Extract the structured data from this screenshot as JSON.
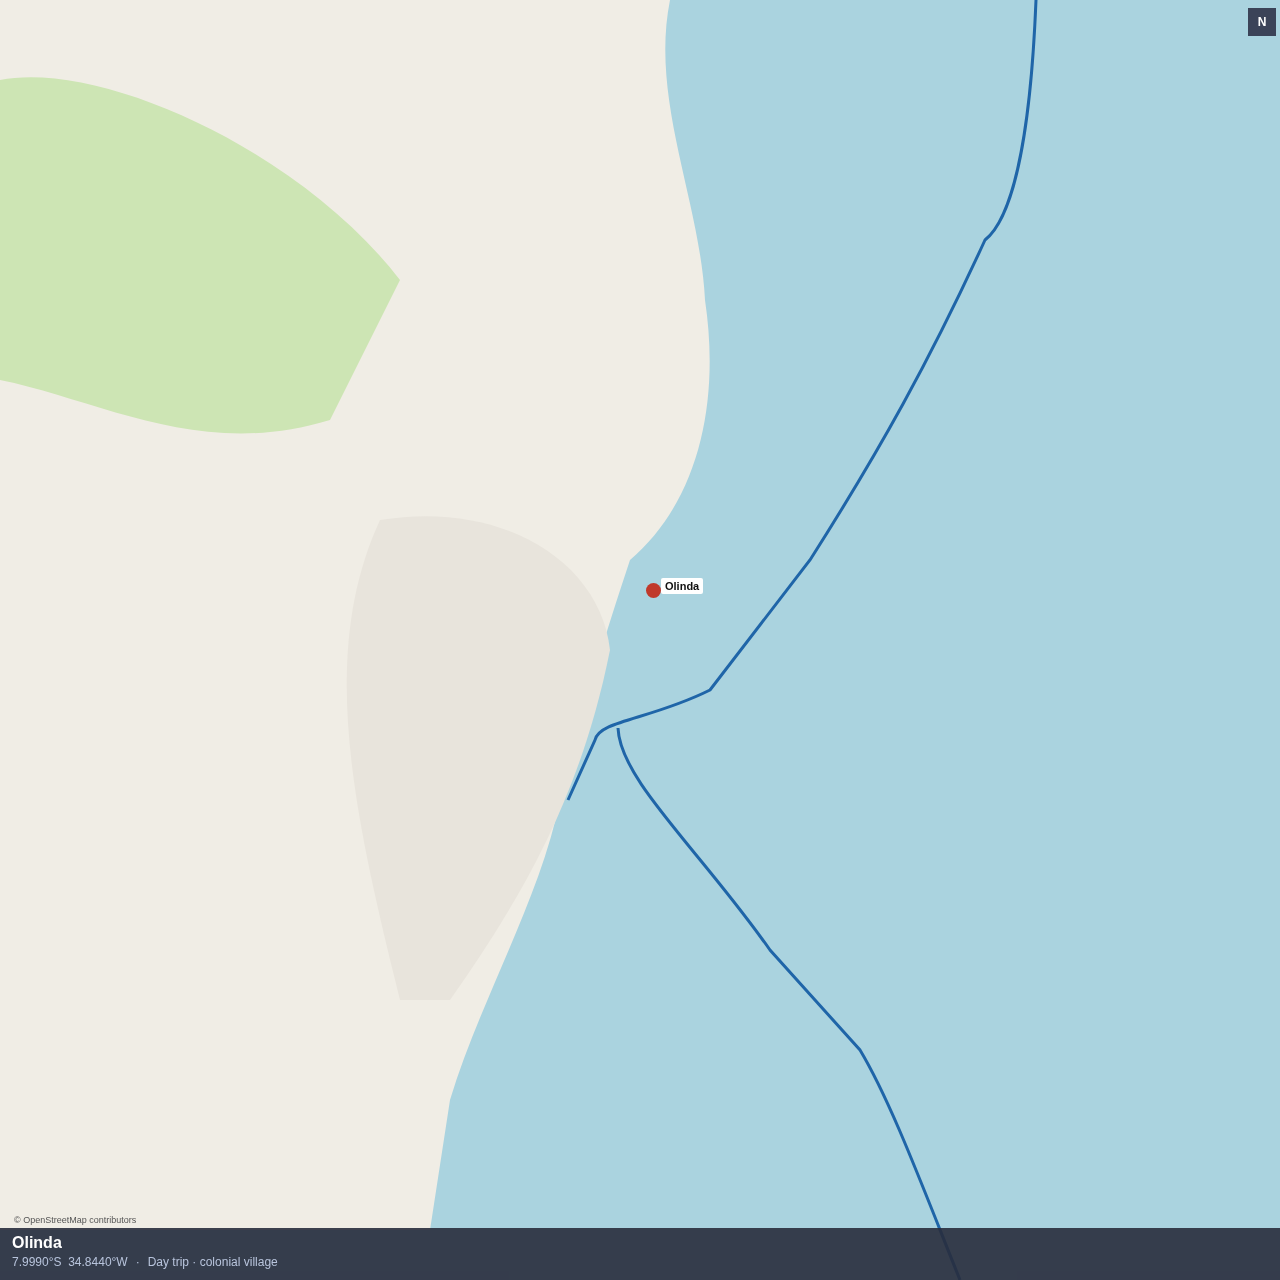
{
  "map": {
    "compass": "N",
    "attribution": "© OpenStreetMap contributors",
    "marker": {
      "label": "Olinda"
    }
  },
  "info_bar": {
    "title": "Olinda",
    "coordinates": "7.9990°S  34.8440°W",
    "separator": "·",
    "description": "Day trip · colonial village"
  }
}
